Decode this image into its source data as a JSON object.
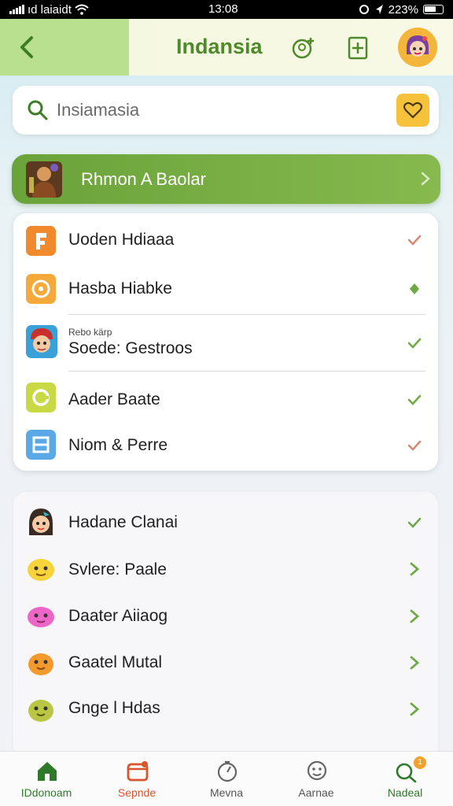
{
  "status_bar": {
    "carrier": "ıd laiaidt",
    "time": "13:08",
    "battery": "223%"
  },
  "header": {
    "title": "Indansia"
  },
  "search": {
    "placeholder": "Insiamasia"
  },
  "banner": {
    "label": "Rhmon A Baolar"
  },
  "list_primary": [
    {
      "label": "Uoden Hdiaaa",
      "sub": "",
      "icon": "orange-flag-app-icon",
      "mark": "check"
    },
    {
      "label": "Hasba Hiabke",
      "sub": "",
      "icon": "orange-circle-app-icon",
      "mark": "diamond"
    },
    {
      "label": "Soede: Gestroos",
      "sub": "Rebo kärp",
      "icon": "cartoon-character-app-icon",
      "mark": "check"
    },
    {
      "label": "Aader Baate",
      "sub": "",
      "icon": "lime-app-icon",
      "mark": "check"
    },
    {
      "label": "Niom & Perre",
      "sub": "",
      "icon": "blue-app-icon",
      "mark": "check"
    }
  ],
  "list_secondary": [
    {
      "label": "Hadane Clanai",
      "icon": "girl-avatar-icon",
      "mark": "check"
    },
    {
      "label": "Svlere: Paale",
      "icon": "yellow-emoji-icon",
      "mark": "chevron"
    },
    {
      "label": "Daater Aiiaog",
      "icon": "pink-emoji-icon",
      "mark": "chevron"
    },
    {
      "label": "Gaatel Mutal",
      "icon": "orange-emoji-icon",
      "mark": "chevron"
    },
    {
      "label": "Gnge l Hdas",
      "icon": "green-emoji-icon",
      "mark": "chevron"
    }
  ],
  "bottom_nav": [
    {
      "label": "IDdonoam",
      "icon": "home-icon"
    },
    {
      "label": "Sepnde",
      "icon": "calendar-icon"
    },
    {
      "label": "Mevna",
      "icon": "timer-icon"
    },
    {
      "label": "Aarnae",
      "icon": "face-icon"
    },
    {
      "label": "Nadeal",
      "icon": "search-badge-icon",
      "badge": "1"
    }
  ],
  "colors": {
    "accent_green": "#6aa33a",
    "check_green": "#6fa944",
    "check_red": "#d98872",
    "nav_active": "#2f7a2a",
    "nav_alt": "#d9542b"
  }
}
